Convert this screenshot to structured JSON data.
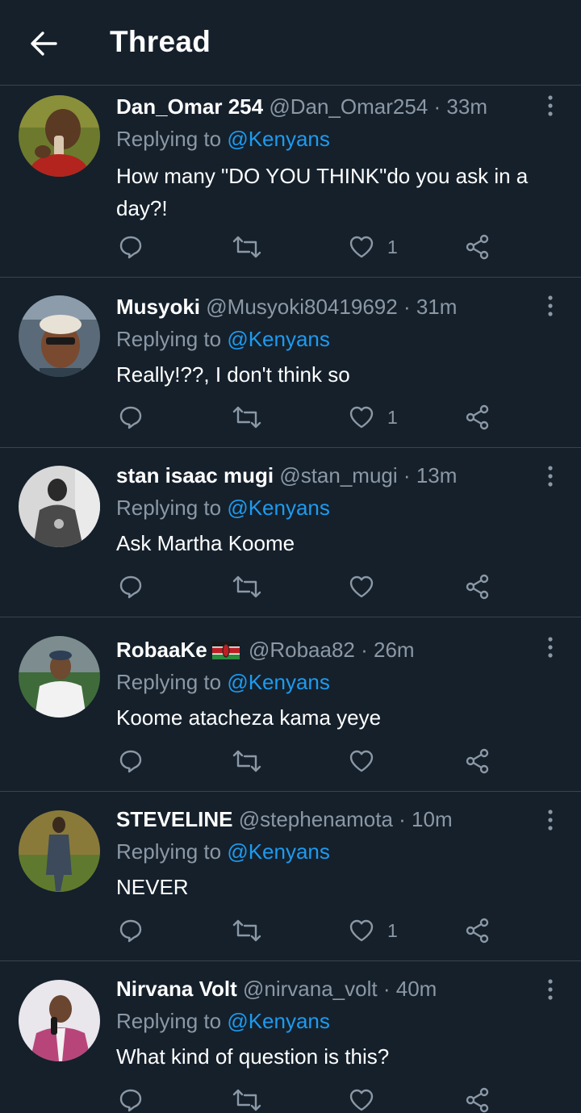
{
  "header": {
    "title": "Thread"
  },
  "tweets": [
    {
      "name": "Dan_Omar 254",
      "handle": "@Dan_Omar254",
      "time": "33m",
      "replying_prefix": "Replying to",
      "mention": "@Kenyans",
      "text": "How many \"DO YOU THINK\"do you ask in a day?!",
      "likes": "1",
      "flag": ""
    },
    {
      "name": "Musyoki",
      "handle": "@Musyoki80419692",
      "time": "31m",
      "replying_prefix": "Replying to",
      "mention": "@Kenyans",
      "text": "Really!??, I don't think so",
      "likes": "1",
      "flag": ""
    },
    {
      "name": "stan isaac mugi",
      "handle": "@stan_mugi",
      "time": "13m",
      "replying_prefix": "Replying to",
      "mention": "@Kenyans",
      "text": "Ask Martha Koome",
      "likes": "",
      "flag": ""
    },
    {
      "name": "RobaaKe",
      "handle": "@Robaa82",
      "time": "26m",
      "replying_prefix": "Replying to",
      "mention": "@Kenyans",
      "text": "Koome atacheza kama yeye",
      "likes": "",
      "flag": "kenya-flag"
    },
    {
      "name": "STEVELINE",
      "handle": "@stephenamota",
      "time": "10m",
      "replying_prefix": "Replying to",
      "mention": "@Kenyans",
      "text": "NEVER",
      "likes": "1",
      "flag": ""
    },
    {
      "name": "Nirvana Volt",
      "handle": "@nirvana_volt",
      "time": "40m",
      "replying_prefix": "Replying to",
      "mention": "@Kenyans",
      "text": "What kind of question is this?",
      "likes": "",
      "flag": ""
    }
  ],
  "separator": "·",
  "icons": {
    "back": "arrow-left-icon",
    "more": "more-vertical-icon",
    "reply": "reply-icon",
    "retweet": "retweet-icon",
    "like": "heart-icon",
    "share": "share-icon"
  },
  "colors": {
    "background": "#15202b",
    "divider": "#38444d",
    "muted": "#8b98a5",
    "accent": "#1d9bf0"
  }
}
